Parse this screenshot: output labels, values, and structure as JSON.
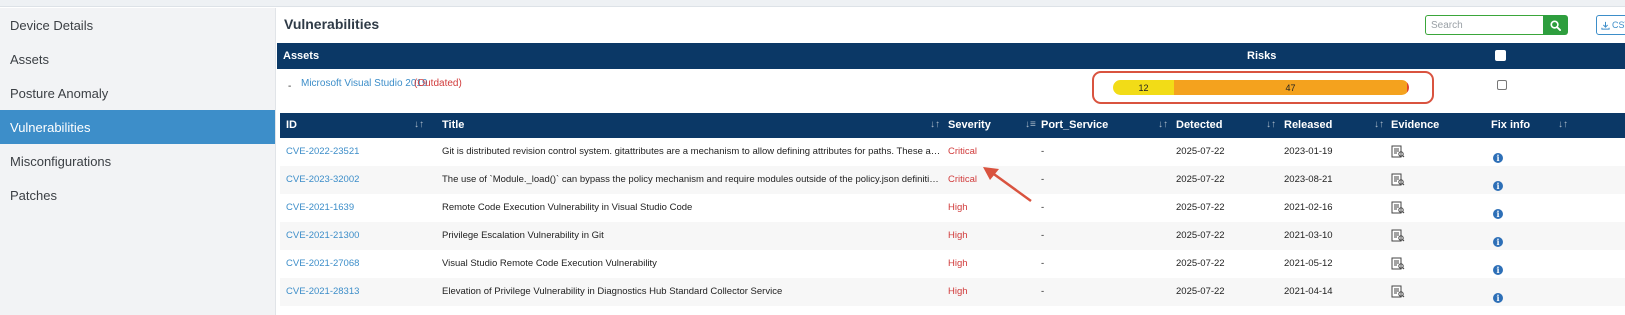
{
  "sidebar": {
    "items": [
      {
        "label": "Device Details"
      },
      {
        "label": "Assets"
      },
      {
        "label": "Posture Anomaly"
      },
      {
        "label": "Vulnerabilities",
        "active": true
      },
      {
        "label": "Misconfigurations"
      },
      {
        "label": "Patches"
      }
    ]
  },
  "page": {
    "title": "Vulnerabilities",
    "search_placeholder": "Search",
    "search_icon": "search-icon",
    "csv_label": "CSV",
    "csv_icon": "download-icon"
  },
  "assets_table": {
    "headers": {
      "assets": "Assets",
      "risks": "Risks"
    },
    "rows": [
      {
        "toggle": "-",
        "name": "Microsoft Visual Studio 2019",
        "status": "(Outdated)",
        "risks": [
          {
            "value": "12",
            "color": "#f2dc17"
          },
          {
            "value": "47",
            "color": "#f4a21e"
          },
          {
            "value": "2",
            "color": "#e0442e"
          }
        ]
      }
    ]
  },
  "vuln_table": {
    "headers": {
      "id": "ID",
      "title": "Title",
      "severity": "Severity",
      "port_service": "Port_Service",
      "detected": "Detected",
      "released": "Released",
      "evidence": "Evidence",
      "fix_info": "Fix info"
    },
    "sort_icon": "sort-icon",
    "rows": [
      {
        "id": "CVE-2022-23521",
        "title": "Git is distributed revision control system. gitattributes are a mechanism to allow defining attributes for paths. These attributes c...",
        "severity": "Critical",
        "port_service": "-",
        "detected": "2025-07-22",
        "released": "2023-01-19"
      },
      {
        "id": "CVE-2023-32002",
        "title": "The use of `Module._load()` can bypass the policy mechanism and require modules outside of the policy.json definition for a gi...",
        "severity": "Critical",
        "port_service": "-",
        "detected": "2025-07-22",
        "released": "2023-08-21"
      },
      {
        "id": "CVE-2021-1639",
        "title": "Remote Code Execution Vulnerability in Visual Studio Code",
        "severity": "High",
        "port_service": "-",
        "detected": "2025-07-22",
        "released": "2021-02-16"
      },
      {
        "id": "CVE-2021-21300",
        "title": "Privilege Escalation Vulnerability in Git",
        "severity": "High",
        "port_service": "-",
        "detected": "2025-07-22",
        "released": "2021-03-10"
      },
      {
        "id": "CVE-2021-27068",
        "title": "Visual Studio Remote Code Execution Vulnerability",
        "severity": "High",
        "port_service": "-",
        "detected": "2025-07-22",
        "released": "2021-05-12"
      },
      {
        "id": "CVE-2021-28313",
        "title": "Elevation of Privilege Vulnerability in Diagnostics Hub Standard Collector Service",
        "severity": "High",
        "port_service": "-",
        "detected": "2025-07-22",
        "released": "2021-04-14"
      }
    ]
  },
  "colors": {
    "nav_active": "#3d8ec9",
    "header_bg": "#0b3866",
    "link": "#3d8ec9",
    "critical": "#d13b3b",
    "search_green": "#2e9e3e",
    "callout": "#d9533f"
  }
}
